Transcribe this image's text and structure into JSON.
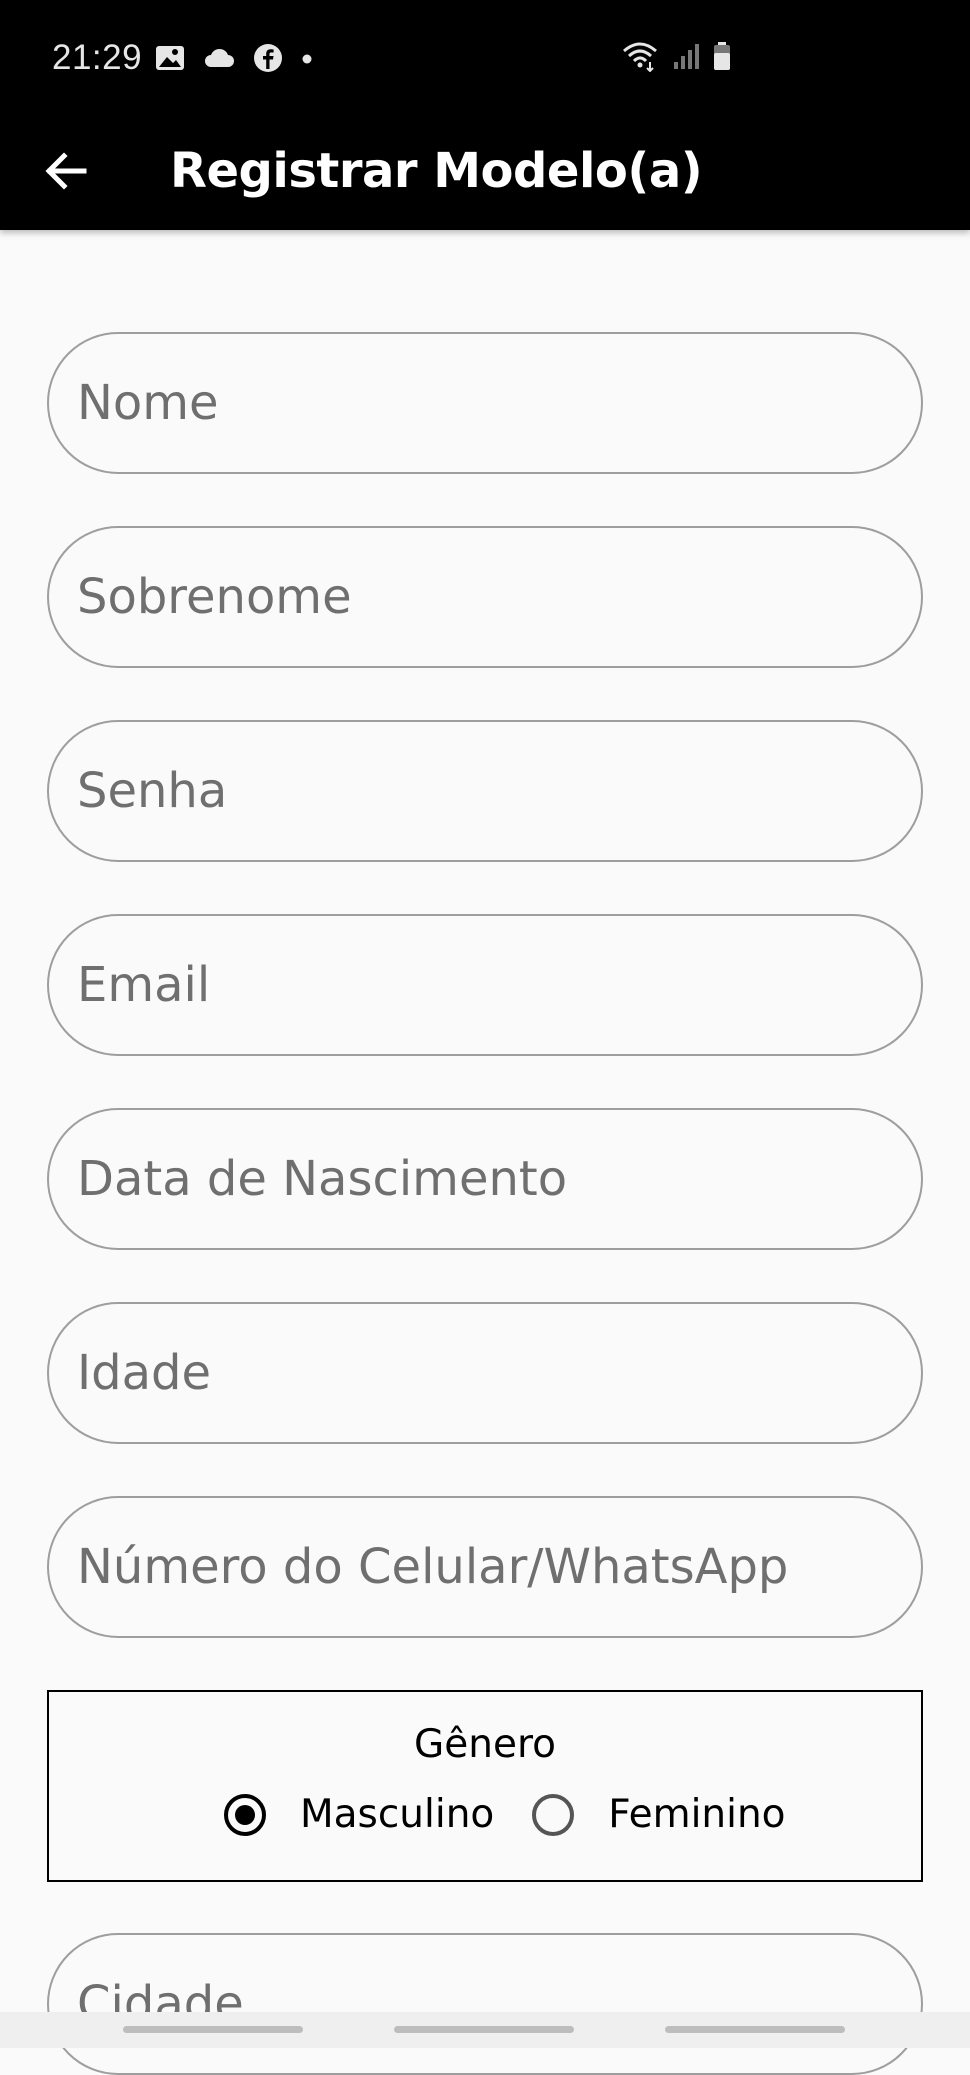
{
  "status_bar": {
    "time": "21:29",
    "left_icons": [
      "image-icon",
      "cloud-icon",
      "facebook-icon",
      "dot-icon"
    ],
    "right_icons": [
      "wifi-icon",
      "signal-icon",
      "battery-icon"
    ]
  },
  "app_bar": {
    "title": "Registrar Modelo(a)",
    "back_icon": "arrow-left-icon"
  },
  "form": {
    "fields": [
      {
        "name": "nome-field",
        "placeholder": "Nome",
        "type": "text"
      },
      {
        "name": "sobrenome-field",
        "placeholder": "Sobrenome",
        "type": "text"
      },
      {
        "name": "senha-field",
        "placeholder": "Senha",
        "type": "password"
      },
      {
        "name": "email-field",
        "placeholder": "Email",
        "type": "email"
      },
      {
        "name": "data-nascimento-field",
        "placeholder": "Data de Nascimento",
        "type": "text"
      },
      {
        "name": "idade-field",
        "placeholder": "Idade",
        "type": "text"
      },
      {
        "name": "celular-field",
        "placeholder": "Número do Celular/WhatsApp",
        "type": "tel"
      }
    ],
    "gender": {
      "title": "Gênero",
      "options": [
        {
          "label": "Masculino",
          "checked": true
        },
        {
          "label": "Feminino",
          "checked": false
        }
      ]
    },
    "cidade_placeholder": "Cidade"
  },
  "colors": {
    "app_bar": "#000000",
    "background": "#fafafa",
    "field_border": "#9e9e9e",
    "placeholder": "#6f6f6f"
  }
}
